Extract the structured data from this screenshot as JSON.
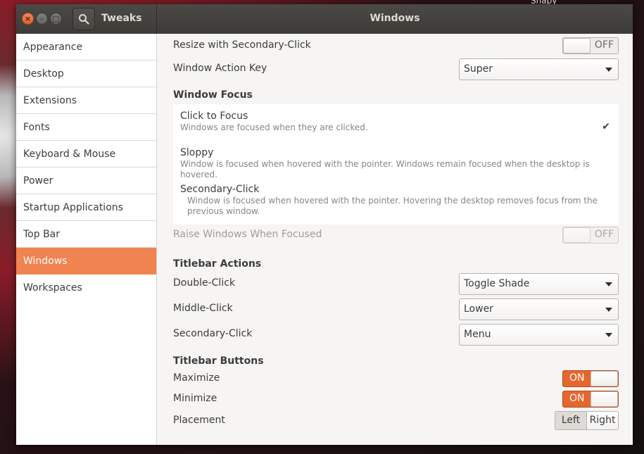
{
  "desktop": {
    "corner_label": "Snapy"
  },
  "header": {
    "app_title": "Tweaks",
    "page_title": "Windows"
  },
  "sidebar": {
    "items": [
      {
        "label": "Appearance"
      },
      {
        "label": "Desktop"
      },
      {
        "label": "Extensions"
      },
      {
        "label": "Fonts"
      },
      {
        "label": "Keyboard & Mouse"
      },
      {
        "label": "Power"
      },
      {
        "label": "Startup Applications"
      },
      {
        "label": "Top Bar"
      },
      {
        "label": "Windows"
      },
      {
        "label": "Workspaces"
      }
    ],
    "active": "Windows"
  },
  "settings": {
    "resize_secondary": {
      "label": "Resize with Secondary-Click",
      "state": "OFF"
    },
    "action_key": {
      "label": "Window Action Key",
      "value": "Super"
    },
    "window_focus": {
      "title": "Window Focus",
      "options": [
        {
          "title": "Click to Focus",
          "desc": "Windows are focused when they are clicked."
        },
        {
          "title": "Sloppy",
          "desc": "Window is focused when hovered with the pointer. Windows remain focused when the desktop is hovered."
        },
        {
          "title": "Secondary-Click",
          "desc": "Window is focused when hovered with the pointer. Hovering the desktop removes focus from the previous window."
        }
      ],
      "selected": "Click to Focus",
      "check": "✔"
    },
    "raise_focused": {
      "label": "Raise Windows When Focused",
      "state": "OFF"
    },
    "titlebar_actions": {
      "title": "Titlebar Actions",
      "double_click": {
        "label": "Double-Click",
        "value": "Toggle Shade"
      },
      "middle_click": {
        "label": "Middle-Click",
        "value": "Lower"
      },
      "secondary_click": {
        "label": "Secondary-Click",
        "value": "Menu"
      }
    },
    "titlebar_buttons": {
      "title": "Titlebar Buttons",
      "maximize": {
        "label": "Maximize",
        "state": "ON"
      },
      "minimize": {
        "label": "Minimize",
        "state": "ON"
      },
      "placement": {
        "label": "Placement",
        "options": [
          "Left",
          "Right"
        ],
        "selected": "Left"
      }
    }
  },
  "icons": {
    "close": "close-icon",
    "minimize": "minimize-icon",
    "maximize": "maximize-icon",
    "search": "search-icon"
  },
  "colors": {
    "accent": "#f0834f",
    "switch_on": "#e6672d",
    "headerbar": "#3d3c39"
  }
}
